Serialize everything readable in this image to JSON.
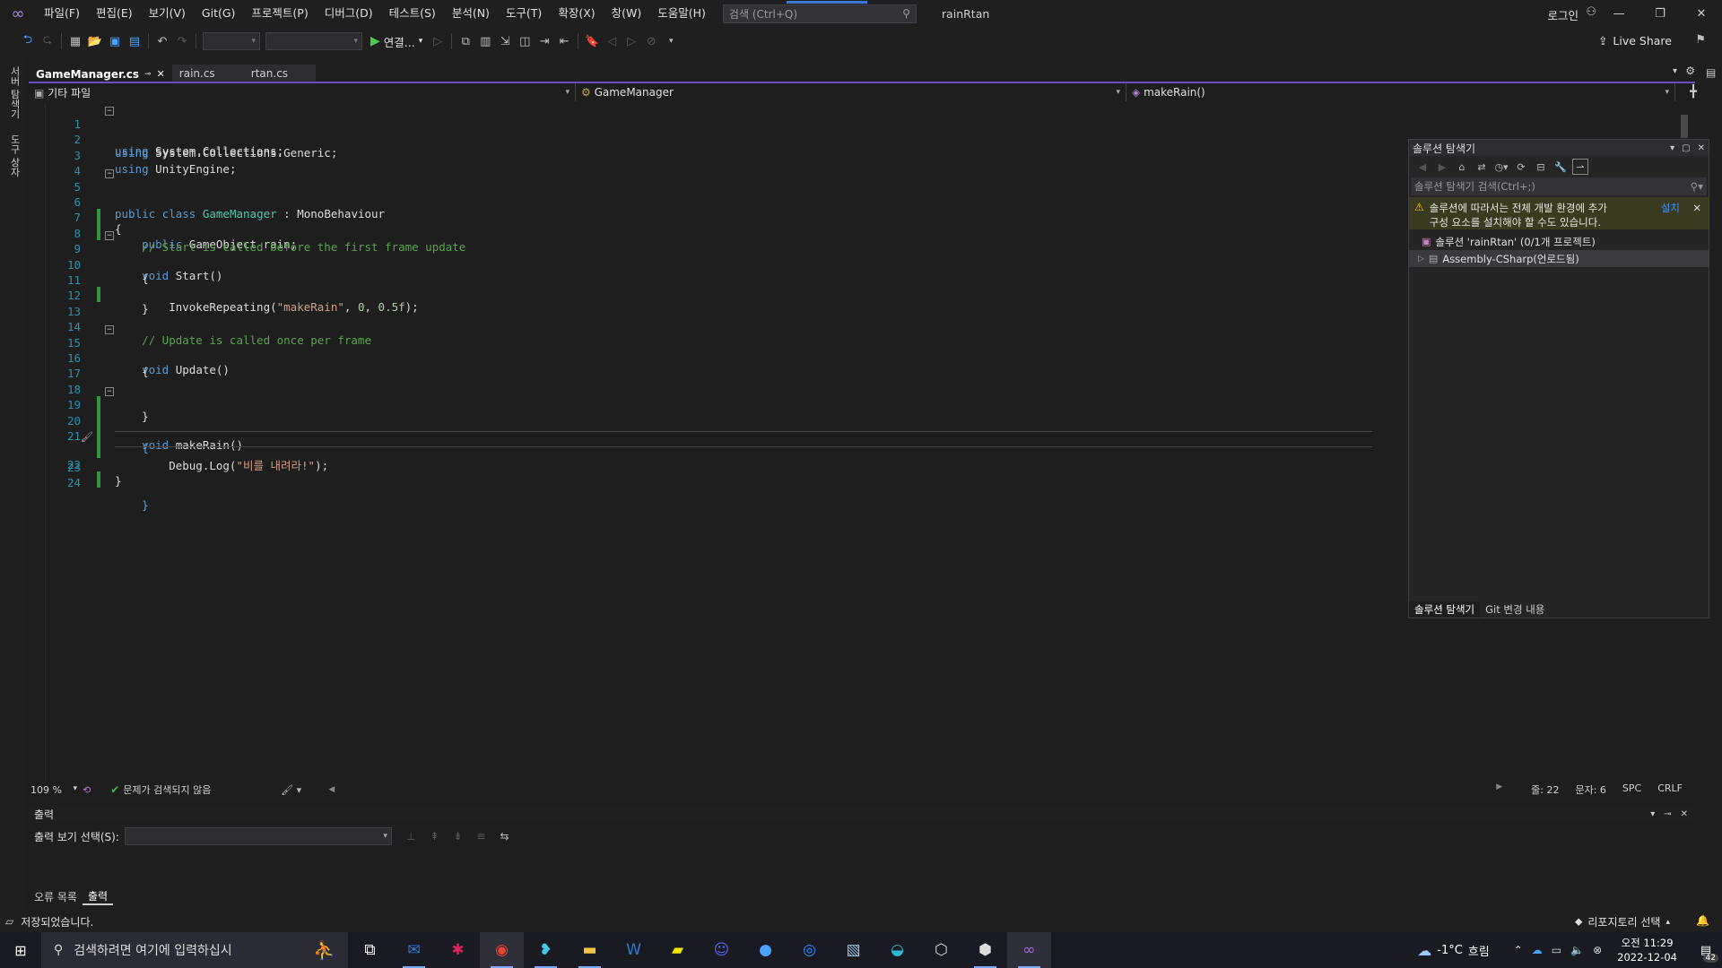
{
  "menu": {
    "items": [
      "파일(F)",
      "편집(E)",
      "보기(V)",
      "Git(G)",
      "프로젝트(P)",
      "디버그(D)",
      "테스트(S)",
      "분석(N)",
      "도구(T)",
      "확장(X)",
      "창(W)",
      "도움말(H)"
    ],
    "search_placeholder": "검색 (Ctrl+Q)",
    "solution_name": "rainRtan",
    "login": "로그인"
  },
  "toolbar": {
    "run_label": "연결...",
    "live_share": "Live Share"
  },
  "side_tabs": {
    "server_explorer": "서버 탐색기",
    "toolbox": "도구 상자"
  },
  "doc_tabs": [
    {
      "label": "GameManager.cs",
      "active": true
    },
    {
      "label": "rain.cs",
      "active": false
    },
    {
      "label": "rtan.cs",
      "active": false
    }
  ],
  "nav_bar": {
    "project": "기타 파일",
    "type": "GameManager",
    "member": "makeRain()"
  },
  "code": {
    "line_numbers": [
      "1",
      "2",
      "3",
      "4",
      "5",
      "6",
      "7",
      "8",
      "9",
      "10",
      "11",
      "12",
      "13",
      "14",
      "15",
      "16",
      "17",
      "18",
      "19",
      "20",
      "21",
      "22",
      "23",
      "24"
    ],
    "lines": [
      "using System.Collections;",
      "using System.Collections.Generic;",
      "using UnityEngine;",
      "",
      "public class GameManager : MonoBehaviour",
      "{",
      "    public GameObject rain;",
      "    // Start is called before the first frame update",
      "    void Start()",
      "    {",
      "        InvokeRepeating(\"makeRain\", 0, 0.5f);",
      "    }",
      "",
      "    // Update is called once per frame",
      "    void Update()",
      "    {",
      "",
      "    }",
      "    void makeRain()",
      "    {",
      "        Debug.Log(\"비를 내려라!\");",
      "    }",
      "}",
      ""
    ],
    "changed_lines": [
      6,
      7,
      11,
      18,
      19,
      20,
      21,
      22
    ],
    "cursor_line": 22
  },
  "editor_status": {
    "zoom": "109 %",
    "issues": "문제가 검색되지 않음",
    "line": "줄: 22",
    "col": "문자: 6",
    "spc": "SPC",
    "eol": "CRLF"
  },
  "solution_explorer": {
    "title": "솔루션 탐색기",
    "search_placeholder": "솔루션 탐색기 검색(Ctrl+;)",
    "warning_line1": "솔루션에 따라서는 전체 개발 환경에 추가",
    "warning_line2": "구성 요소를 설치해야 할 수도 있습니다.",
    "install_link": "설치",
    "solution_node": "솔루션 'rainRtan' (0/1개 프로젝트)",
    "project_node": "Assembly-CSharp(언로드됨)",
    "tab_explorer": "솔루션 탐색기",
    "tab_git": "Git 변경 내용"
  },
  "output": {
    "title": "출력",
    "source_label": "출력 보기 선택(S):",
    "source_value": ""
  },
  "bottom_tabs": [
    "오류 목록",
    "출력"
  ],
  "status": {
    "message": "저장되었습니다.",
    "repo": "리포지토리 선택"
  },
  "taskbar": {
    "search_placeholder": "검색하려면 여기에 입력하십시",
    "weather_temp": "-1°C",
    "weather_desc": "흐림",
    "time": "오전 11:29",
    "date": "2022-12-04",
    "notification_count": "42"
  },
  "colors": {
    "accent_purple": "#6d4cc7",
    "change_green": "#2e9a3e",
    "keyword_blue": "#569cd6",
    "type_teal": "#4ec9b0",
    "comment_green": "#57a64a",
    "string_orange": "#d69d85"
  }
}
